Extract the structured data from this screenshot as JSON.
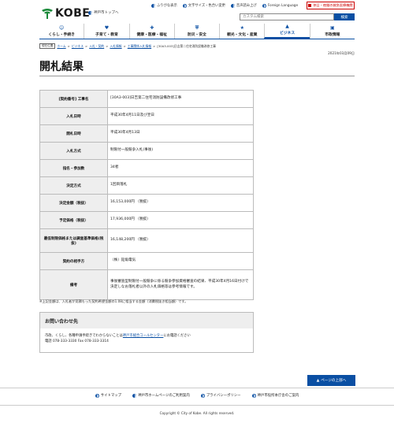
{
  "header": {
    "logo_text": "KOBE",
    "top_link": "神戸市トップへ",
    "util": [
      "ふりがな表示",
      "文字サイズ・色合い変更",
      "音声読み上げ",
      "Foreign Language"
    ],
    "emergency": "休日・夜間の救急医療機関",
    "search_placeholder": "カスタム検索",
    "search_button": "検索"
  },
  "gnav": [
    {
      "icon": "child-icon",
      "glyph": "☺",
      "label": "くらし・手続き"
    },
    {
      "icon": "family-icon",
      "glyph": "♥",
      "label": "子育て・教育"
    },
    {
      "icon": "health-icon",
      "glyph": "✚",
      "label": "健康・医療・福祉"
    },
    {
      "icon": "safety-icon",
      "glyph": "⛨",
      "label": "防災・安全"
    },
    {
      "icon": "culture-icon",
      "glyph": "★",
      "label": "観光・文化・産業"
    },
    {
      "icon": "business-icon",
      "glyph": "▲",
      "label": "ビジネス"
    },
    {
      "icon": "city-icon",
      "glyph": "▣",
      "label": "市政情報"
    }
  ],
  "gnav_active_index": 5,
  "breadcrumb": {
    "here": "現在位置",
    "items": [
      "ホーム",
      "ビジネス",
      "入札・契約",
      "入札情報",
      "工事関係入札情報"
    ],
    "current": "[30A3-003]日吉第二住宅消防設備改修工事"
  },
  "date": "2021年03月09日",
  "title": "開札結果",
  "table": [
    {
      "label": "[契約番号] 工事名",
      "value": "[30A3-003]日吉第二住宅消防設備改修工事"
    },
    {
      "label": "入札日時",
      "value": "平成30年4月11日及び翌日"
    },
    {
      "label": "開札日時",
      "value": "平成30年4月13日"
    },
    {
      "label": "入札方式",
      "value": "制限付一般競争入札(事後)"
    },
    {
      "label": "指名・参加数",
      "value": "34者"
    },
    {
      "label": "決定方式",
      "value": "1回目落札"
    },
    {
      "label": "決定金額（税抜）",
      "value": "16,153,000円 （税抜）"
    },
    {
      "label": "予定価格（税抜）",
      "value": "17,936,000円 （税抜）"
    },
    {
      "label": "最低制限価格または調査基準価格(税抜)",
      "value": "16,148,200円 （税抜）"
    },
    {
      "label": "契約の相手方",
      "value": "（株）鉛角電気"
    },
    {
      "label": "備考",
      "value": "事後審査型制限付一般競争に係る競争参加資格審査の結果、平成30年4月16日付けで決定しなお落札者以外の入札価格等は参考情報です。"
    }
  ],
  "note": "※上記金額は、入札者が見積もった契約希望金額の1.08に相当する金額（消費税抜き相当額）です。",
  "contact": {
    "heading": "お問い合わせ先",
    "line1_a": "市政、くらし、各種申請手続きでわからないことは",
    "line1_link": "神戸市総合コールセンター",
    "line1_b": "にお電話ください",
    "line2": "電話 078-333-3330 Fax 078-333-3314"
  },
  "pagetop": "ページの上部へ",
  "footer": {
    "links": [
      "サイトマップ",
      "神戸市ホームページのご利用案内",
      "プライバシーポリシー",
      "神戸市役所本庁舎のご案内"
    ],
    "copyright": "Copyright © City of Kobe. All rights reserved."
  },
  "colors": {
    "brand": "#0a4fa3",
    "green": "#1a8a3a",
    "alert": "#cc0000"
  }
}
